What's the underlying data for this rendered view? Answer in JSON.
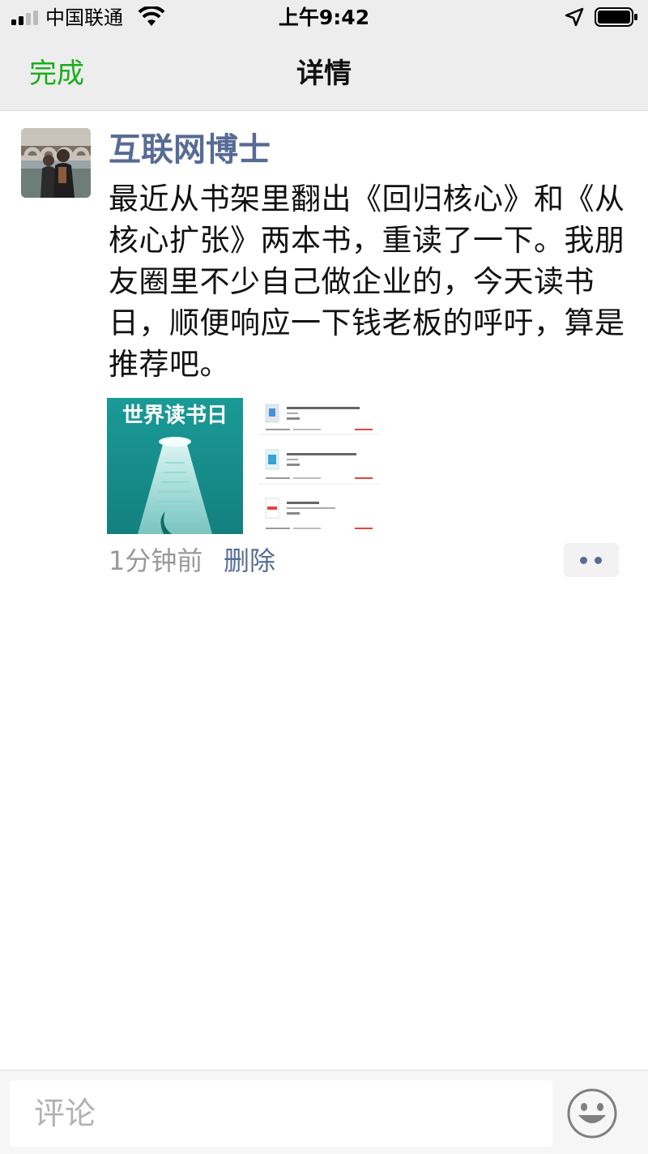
{
  "status_bar": {
    "carrier": "中国联通",
    "time": "上午9:42"
  },
  "nav": {
    "done_label": "完成",
    "title": "详情"
  },
  "post": {
    "author": "互联网博士",
    "content": "最近从书架里翻出《回归核心》和《从核心扩张》两本书，重读了一下。我朋友圈里不少自己做企业的，今天读书日，顺便响应一下钱老板的呼吁，算是推荐吧。",
    "image1_text": "世界读书日",
    "time": "1分钟前",
    "delete_label": "删除"
  },
  "comment_bar": {
    "placeholder": "评论"
  },
  "colors": {
    "accent_green": "#1aad19",
    "link_blue": "#576b95"
  }
}
